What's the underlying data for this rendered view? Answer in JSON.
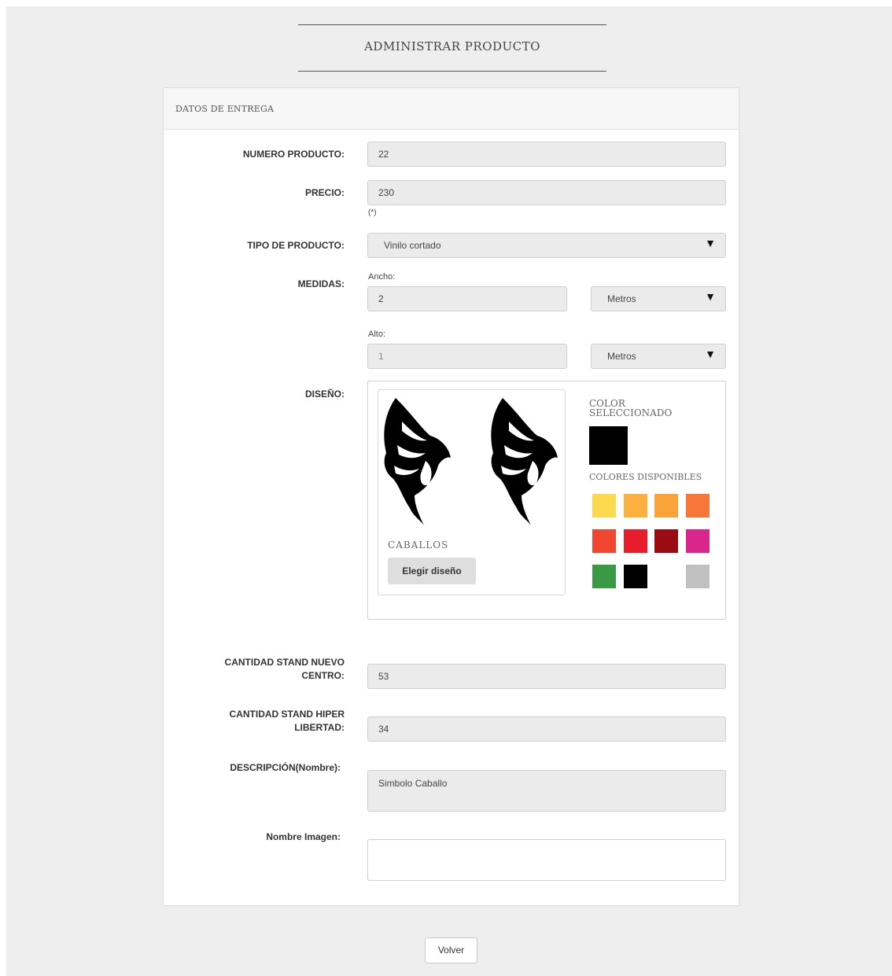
{
  "header": {
    "title": "ADMINISTRAR PRODUCTO"
  },
  "panel": {
    "title": "DATOS DE ENTREGA"
  },
  "form": {
    "numero_producto": {
      "label": "NUMERO PRODUCTO:",
      "value": "22"
    },
    "precio": {
      "label": "PRECIO:",
      "value": "230",
      "note": "(*)"
    },
    "tipo_producto": {
      "label": "TIPO DE PRODUCTO:",
      "value": "Vinilo cortado"
    },
    "medidas": {
      "label": "MEDIDAS:",
      "ancho_label": "Ancho:",
      "ancho_value": "2",
      "ancho_unit": "Metros",
      "alto_label": "Alto:",
      "alto_value": "1",
      "alto_unit": "Metros"
    },
    "diseno": {
      "label": "DISEÑO:",
      "design_name": "CABALLOS",
      "choose_button": "Elegir diseño",
      "selected_color_label": "COLOR SELECCIONADO",
      "selected_color": "#000000",
      "available_label": "COLORES DISPONIBLES",
      "colors": [
        "#fcd94e",
        "#fbb040",
        "#f9a33a",
        "#f7773b",
        "#f04632",
        "#e91c2b",
        "#9b0b12",
        "#d9268a",
        "#3a9a43",
        "#000000",
        "#ffffff",
        "#c0c0c0"
      ]
    },
    "stand_nuevo_centro": {
      "label_line1": "CANTIDAD STAND NUEVO",
      "label_line2": "CENTRO:",
      "value": "53"
    },
    "stand_hiper_libertad": {
      "label_line1": "CANTIDAD STAND HIPER",
      "label_line2": "LIBERTAD:",
      "value": "34"
    },
    "descripcion": {
      "label": "DESCRIPCIÓN(Nombre):",
      "value": "Simbolo Caballo"
    },
    "nombre_imagen": {
      "label": "Nombre Imagen:",
      "value": ""
    }
  },
  "footer": {
    "back_button": "Volver"
  }
}
